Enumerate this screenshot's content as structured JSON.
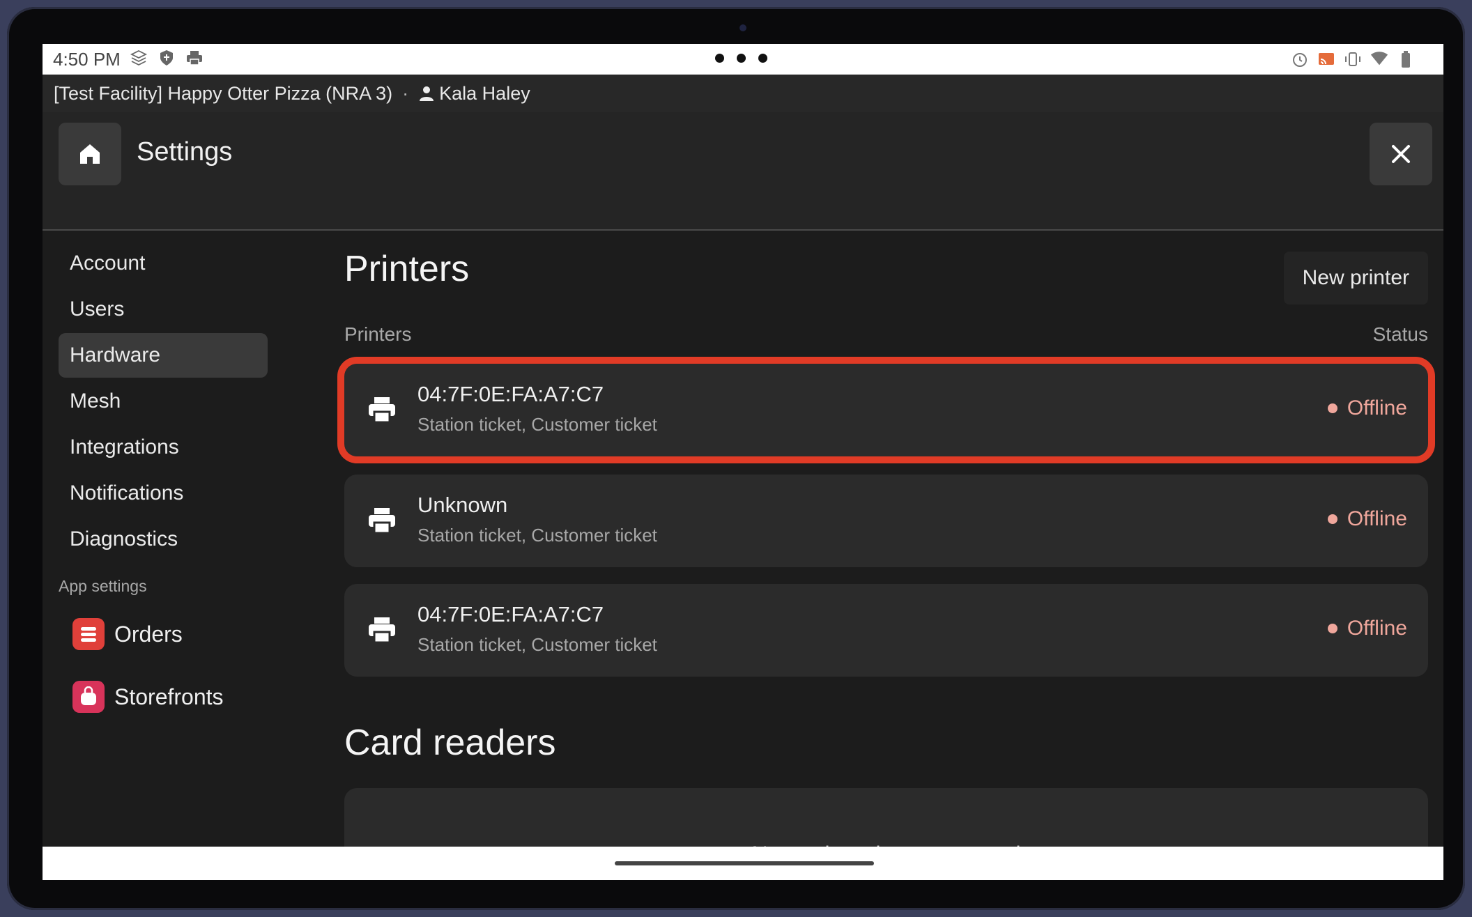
{
  "status_bar": {
    "time": "4:50 PM",
    "left_icons": [
      "layers-icon",
      "shield-icon",
      "printer-icon"
    ],
    "right_icons": [
      "alarm-icon",
      "cast-icon",
      "vibrate-icon",
      "wifi-icon",
      "battery-icon"
    ]
  },
  "facility_bar": {
    "facility": "[Test Facility] Happy Otter Pizza (NRA 3)",
    "separator": "·",
    "user_name": "Kala Haley"
  },
  "header": {
    "title": "Settings"
  },
  "sidebar": {
    "items": [
      {
        "label": "Account"
      },
      {
        "label": "Users"
      },
      {
        "label": "Hardware",
        "active": true
      },
      {
        "label": "Mesh"
      },
      {
        "label": "Integrations"
      },
      {
        "label": "Notifications"
      },
      {
        "label": "Diagnostics"
      }
    ],
    "section_label": "App settings",
    "apps": [
      {
        "label": "Orders",
        "icon": "orders-app-icon",
        "color": "#e0403a"
      },
      {
        "label": "Storefronts",
        "icon": "storefronts-app-icon",
        "color": "#d8335a"
      }
    ]
  },
  "printers": {
    "title": "Printers",
    "new_button_label": "New printer",
    "column_name": "Printers",
    "column_status": "Status",
    "rows": [
      {
        "name": "04:7F:0E:FA:A7:C7",
        "roles": "Station ticket, Customer ticket",
        "status": "Offline",
        "highlighted": true
      },
      {
        "name": "Unknown",
        "roles": "Station ticket, Customer ticket",
        "status": "Offline"
      },
      {
        "name": "04:7F:0E:FA:A7:C7",
        "roles": "Station ticket, Customer ticket",
        "status": "Offline"
      }
    ]
  },
  "card_readers": {
    "title": "Card readers",
    "empty_text": "No card readers connected"
  },
  "colors": {
    "offline": "#f0a79c",
    "highlight": "#e13b26"
  }
}
